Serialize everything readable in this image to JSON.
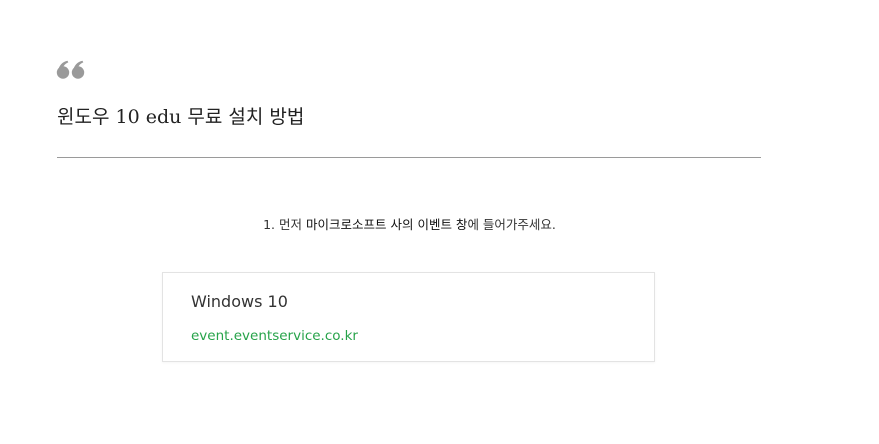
{
  "header": {
    "title": "윈도우 10 edu 무료 설치 방법",
    "quote_icon": "quote-icon"
  },
  "step": {
    "number": "1.",
    "text_before": "먼저",
    "highlight_1": "마이크로소프트 사의 이벤트 창",
    "text_after": "에 들어가주세요."
  },
  "link_card": {
    "title": "Windows 10",
    "url": "event.eventservice.co.kr"
  },
  "colors": {
    "quote": "#9a9a9a",
    "link": "#27a34a",
    "divider": "#9a9a9a"
  }
}
